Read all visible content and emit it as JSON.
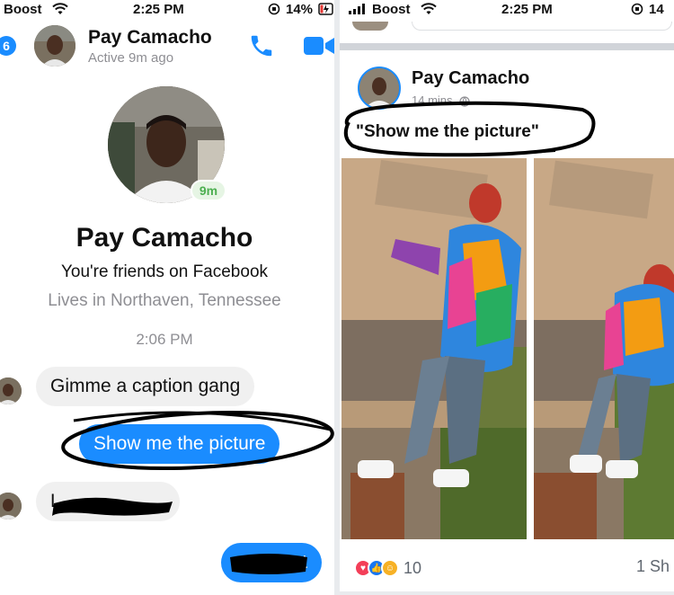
{
  "left": {
    "status": {
      "carrier": "Boost",
      "time": "2:25 PM",
      "battery": "14%"
    },
    "header": {
      "back_count": "6",
      "name": "Pay Camacho",
      "active_status": "Active 9m ago"
    },
    "profile": {
      "active_badge": "9m",
      "name": "Pay Camacho",
      "friends_text": "You're friends on Facebook",
      "lives_text": "Lives in Northaven, Tennessee"
    },
    "timestamp": "2:06 PM",
    "messages": {
      "incoming_1": "Gimme a caption gang",
      "outgoing_1": "Show me the picture",
      "incoming_2": "L",
      "outgoing_2": "t"
    }
  },
  "right": {
    "status": {
      "carrier": "Boost",
      "time": "2:25 PM",
      "battery": "14"
    },
    "post": {
      "author": "Pay Camacho",
      "time": "14 mins",
      "text": "\"Show me the picture\"",
      "reaction_count": "10",
      "shares": "1 Sh"
    }
  },
  "colors": {
    "messenger_blue": "#1a8cff",
    "bubble_grey": "#f0f0f0",
    "muted_text": "#8e8e93",
    "active_green": "#4caf50"
  },
  "icons": {
    "phone": "phone-icon",
    "video": "video-icon",
    "wifi": "wifi-icon",
    "signal": "signal-icon",
    "battery": "battery-icon",
    "globe": "globe-icon",
    "love": "love-reaction-icon",
    "like": "like-reaction-icon",
    "haha": "haha-reaction-icon"
  }
}
